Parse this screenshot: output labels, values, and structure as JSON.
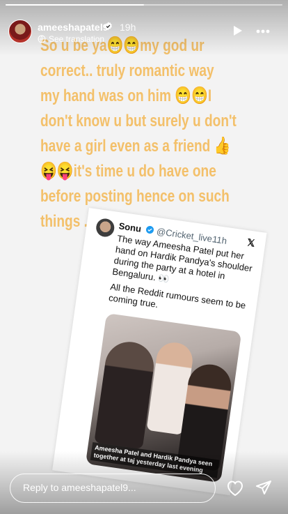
{
  "story": {
    "progress": 0.5,
    "username": "ameeshapatel9",
    "time": "19h",
    "see_translation": "See translation",
    "caption": "So u be ya😁😁my god ur\ncorrect.. truly romantic way\nmy hand was on him 😁😁I\ndon't know u but surely u don't\nhave a girl even as a friend 👍\n😝😝it's time u do have one\nbefore posting  hence on such\nthings .."
  },
  "tweet": {
    "name": "Sonu",
    "handle": "@Cricket_live...",
    "time": "· 11h",
    "x_glyph": "𝕏",
    "body": "The way Ameesha Patel put her hand on Hardik Pandya's shoulder during the party at a hotel in Bengaluru. 👀",
    "body2": "All the Reddit rumours seem to be coming true.",
    "photo_caption": "Ameesha Patel and Hardik Pandya seen together at taj yesterday last evening"
  },
  "reply": {
    "placeholder": "Reply to ameeshapatel9..."
  },
  "colors": {
    "caption_text": "#f3c06a",
    "verified": "#3897f0"
  }
}
